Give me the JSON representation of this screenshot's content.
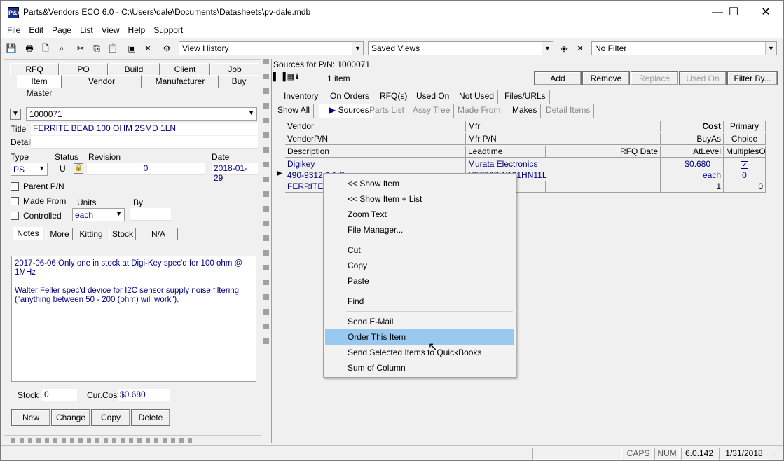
{
  "window": {
    "title": "Parts&Vendors ECO 6.0 - C:\\Users\\dale\\Documents\\Datasheets\\pv-dale.mdb",
    "app_icon": "P&V",
    "minimize": "—",
    "maximize": "☐",
    "close": "✕"
  },
  "menubar": [
    "File",
    "Edit",
    "Page",
    "List",
    "View",
    "Help",
    "Support"
  ],
  "toolbar": {
    "history": "View History",
    "saved_views": "Saved Views",
    "filter": "No Filter"
  },
  "left_tabs": {
    "row1": [
      "RFQ",
      "PO",
      "Build",
      "Client",
      "Job"
    ],
    "row2": [
      "Item Master",
      "Vendor",
      "Manufacturer",
      "Buy"
    ]
  },
  "item": {
    "pn": "1000071",
    "title_label": "Title",
    "title": "FERRITE BEAD 100 OHM 2SMD 1LN",
    "detail_label": "Detail",
    "type_label": "Type",
    "type": "PS",
    "status_label": "Status",
    "status": "U",
    "revision_label": "Revision",
    "revision": "0",
    "date_label": "Date",
    "date": "2018-01-29",
    "parent_label": "Parent P/N",
    "made_from_label": "Made From",
    "controlled_label": "Controlled",
    "units_label": "Units",
    "units": "each",
    "by_label": "By"
  },
  "notes_tabs": [
    "Notes",
    "More",
    "Kitting",
    "Stock",
    "N/A"
  ],
  "notes": {
    "line1": "2017-06-06 Only one in stock at Digi-Key spec'd for 100 ohm @ 1MHz",
    "line2": "Walter Feller spec'd device for I2C sensor supply noise filtering (\"anything between 50 - 200 (ohm) will work\")."
  },
  "stock": {
    "stock_label": "Stock",
    "stock": "0",
    "cost_label": "Cur.Cost",
    "cost": "$0.680"
  },
  "buttons": {
    "new": "New",
    "change": "Change",
    "copy": "Copy",
    "delete": "Delete"
  },
  "sources": {
    "header": "Sources for P/N: 1000071",
    "count": "1 item",
    "add": "Add",
    "remove": "Remove",
    "replace": "Replace",
    "used_on": "Used On",
    "filter_by": "Filter By..."
  },
  "right_tabs": {
    "row1": [
      "Inventory",
      "On Orders",
      "RFQ(s)",
      "Used On",
      "Not Used",
      "Files/URLs"
    ],
    "row2": [
      "Show All",
      "Sources",
      "Parts List",
      "Assy Tree",
      "Made From",
      "Makes",
      "Detail Items"
    ]
  },
  "grid": {
    "headers": {
      "vendor": "Vendor",
      "mfr": "Mfr",
      "cost": "Cost",
      "primary": "Primary",
      "vendor_pn": "VendorP/N",
      "mfr_pn": "Mfr P/N",
      "buyas": "BuyAs",
      "choice": "Choice",
      "description": "Description",
      "leadtime": "Leadtime",
      "rfq_date": "RFQ Date",
      "atlevel": "AtLevel",
      "multiples": "MultiplesOf"
    },
    "row": {
      "vendor": "Digikey",
      "mfr": "Murata Electronics",
      "cost": "$0.680",
      "vendor_pn": "490-9312-1-ND",
      "mfr_pn": "NFZ32BW101HN11L",
      "buyas": "each",
      "choice": "0",
      "description": "FERRITE BEAD 100 OHM 2SMD 1LN",
      "atlevel": "1",
      "multiples": "0"
    }
  },
  "context_menu": [
    "<< Show Item",
    "<< Show Item + List",
    "Zoom Text",
    "File Manager...",
    "Cut",
    "Copy",
    "Paste",
    "Find",
    "Send E-Mail",
    "Order This Item",
    "Send Selected Items to QuickBooks",
    "Sum of Column"
  ],
  "context_menu_highlighted": "Order This Item",
  "statusbar": {
    "caps": "CAPS",
    "num": "NUM",
    "version": "6.0.142",
    "date": "1/31/2018"
  },
  "colors": {
    "accent": "#99c9ef",
    "link_blue": "#000080"
  }
}
